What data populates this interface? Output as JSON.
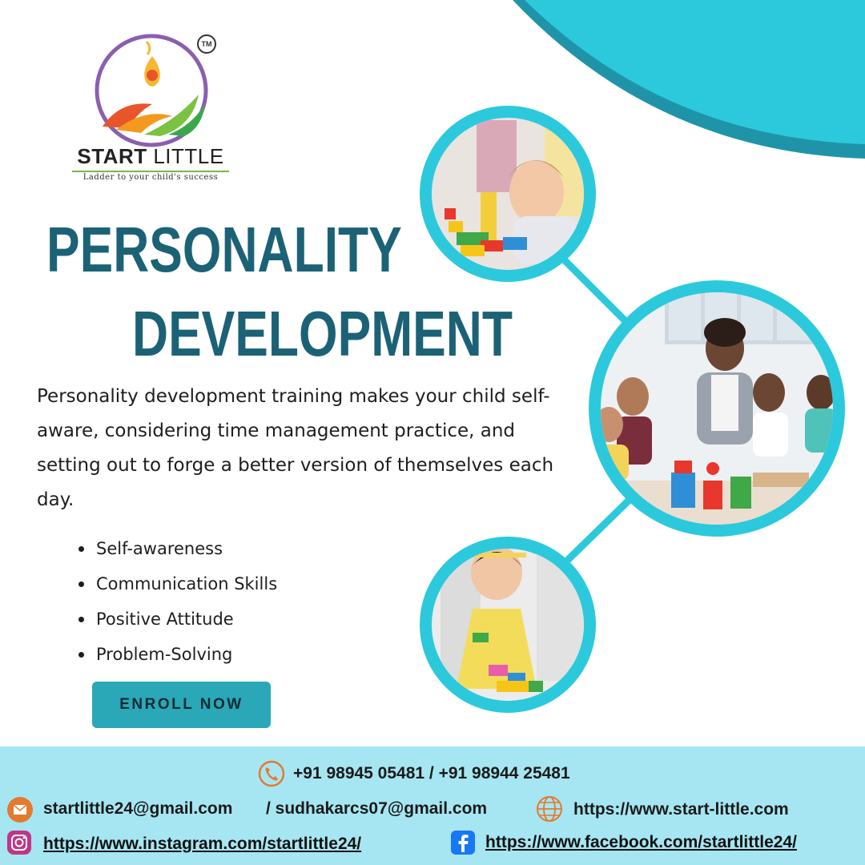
{
  "brand": {
    "name_bold": "START",
    "name_light": " LITTLE",
    "tagline": "Ladder to your child's success",
    "tm": "TM"
  },
  "heading": {
    "line1": "PERSONALITY",
    "line2": "DEVELOPMENT"
  },
  "description": "Personality development training makes your child self-aware, considering time management practice, and setting out to forge a better version of themselves each day.",
  "bullets": [
    "Self-awareness",
    "Communication Skills",
    "Positive Attitude",
    "Problem-Solving"
  ],
  "cta": {
    "label": "ENROLL NOW"
  },
  "contact": {
    "phone": "+91 98945 05481 / +91 98944 25481",
    "email1": "startlittle24@gmail.com",
    "email2": "/ sudhakarcs07@gmail.com",
    "website": "https://www.start-little.com",
    "instagram": "https://www.instagram.com/startlittle24/",
    "facebook": "https://www.facebook.com/startlittle24/"
  },
  "colors": {
    "accent": "#2bc5d8",
    "heading": "#1c6276",
    "footer_bg": "#a6e6f2",
    "button": "#2aa8b8"
  },
  "icons": [
    "phone-icon",
    "email-icon",
    "globe-icon",
    "instagram-icon",
    "facebook-icon"
  ]
}
